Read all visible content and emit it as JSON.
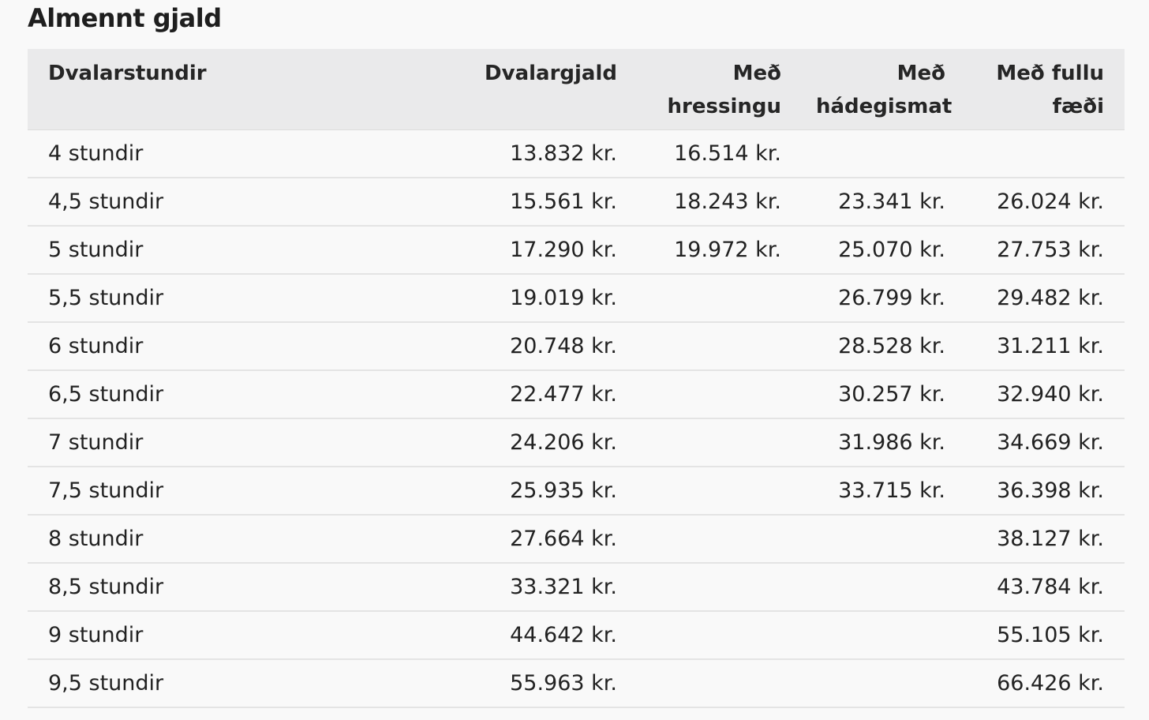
{
  "title": "Almennt gjald",
  "table": {
    "headers": [
      "Dvalarstundir",
      "Dvalargjald",
      "Með hressingu",
      "Með hádegismat",
      "Með fullu fæði"
    ],
    "rows": [
      [
        "4 stundir",
        "13.832 kr.",
        "16.514 kr.",
        "",
        ""
      ],
      [
        "4,5 stundir",
        "15.561 kr.",
        "18.243 kr.",
        "23.341 kr.",
        "26.024 kr."
      ],
      [
        "5 stundir",
        "17.290 kr.",
        "19.972 kr.",
        "25.070 kr.",
        "27.753 kr."
      ],
      [
        "5,5 stundir",
        "19.019 kr.",
        "",
        "26.799 kr.",
        "29.482 kr."
      ],
      [
        "6 stundir",
        "20.748 kr.",
        "",
        "28.528 kr.",
        "31.211 kr."
      ],
      [
        "6,5 stundir",
        "22.477 kr.",
        "",
        "30.257 kr.",
        "32.940 kr."
      ],
      [
        "7 stundir",
        "24.206 kr.",
        "",
        "31.986 kr.",
        "34.669 kr."
      ],
      [
        "7,5 stundir",
        "25.935 kr.",
        "",
        "33.715 kr.",
        "36.398 kr."
      ],
      [
        "8 stundir",
        "27.664 kr.",
        "",
        "",
        "38.127 kr."
      ],
      [
        "8,5 stundir",
        "33.321 kr.",
        "",
        "",
        "43.784 kr."
      ],
      [
        "9 stundir",
        "44.642 kr.",
        "",
        "",
        "55.105 kr."
      ],
      [
        "9,5 stundir",
        "55.963 kr.",
        "",
        "",
        "66.426 kr."
      ]
    ]
  }
}
